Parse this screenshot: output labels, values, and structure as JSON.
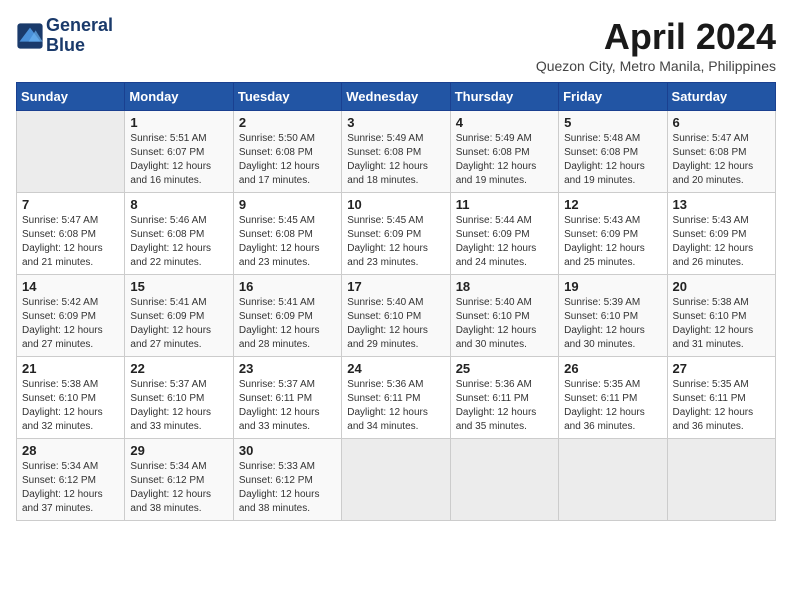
{
  "header": {
    "logo_line1": "General",
    "logo_line2": "Blue",
    "month_title": "April 2024",
    "subtitle": "Quezon City, Metro Manila, Philippines"
  },
  "weekdays": [
    "Sunday",
    "Monday",
    "Tuesday",
    "Wednesday",
    "Thursday",
    "Friday",
    "Saturday"
  ],
  "weeks": [
    [
      {
        "day": "",
        "info": ""
      },
      {
        "day": "1",
        "info": "Sunrise: 5:51 AM\nSunset: 6:07 PM\nDaylight: 12 hours\nand 16 minutes."
      },
      {
        "day": "2",
        "info": "Sunrise: 5:50 AM\nSunset: 6:08 PM\nDaylight: 12 hours\nand 17 minutes."
      },
      {
        "day": "3",
        "info": "Sunrise: 5:49 AM\nSunset: 6:08 PM\nDaylight: 12 hours\nand 18 minutes."
      },
      {
        "day": "4",
        "info": "Sunrise: 5:49 AM\nSunset: 6:08 PM\nDaylight: 12 hours\nand 19 minutes."
      },
      {
        "day": "5",
        "info": "Sunrise: 5:48 AM\nSunset: 6:08 PM\nDaylight: 12 hours\nand 19 minutes."
      },
      {
        "day": "6",
        "info": "Sunrise: 5:47 AM\nSunset: 6:08 PM\nDaylight: 12 hours\nand 20 minutes."
      }
    ],
    [
      {
        "day": "7",
        "info": "Sunrise: 5:47 AM\nSunset: 6:08 PM\nDaylight: 12 hours\nand 21 minutes."
      },
      {
        "day": "8",
        "info": "Sunrise: 5:46 AM\nSunset: 6:08 PM\nDaylight: 12 hours\nand 22 minutes."
      },
      {
        "day": "9",
        "info": "Sunrise: 5:45 AM\nSunset: 6:08 PM\nDaylight: 12 hours\nand 23 minutes."
      },
      {
        "day": "10",
        "info": "Sunrise: 5:45 AM\nSunset: 6:09 PM\nDaylight: 12 hours\nand 23 minutes."
      },
      {
        "day": "11",
        "info": "Sunrise: 5:44 AM\nSunset: 6:09 PM\nDaylight: 12 hours\nand 24 minutes."
      },
      {
        "day": "12",
        "info": "Sunrise: 5:43 AM\nSunset: 6:09 PM\nDaylight: 12 hours\nand 25 minutes."
      },
      {
        "day": "13",
        "info": "Sunrise: 5:43 AM\nSunset: 6:09 PM\nDaylight: 12 hours\nand 26 minutes."
      }
    ],
    [
      {
        "day": "14",
        "info": "Sunrise: 5:42 AM\nSunset: 6:09 PM\nDaylight: 12 hours\nand 27 minutes."
      },
      {
        "day": "15",
        "info": "Sunrise: 5:41 AM\nSunset: 6:09 PM\nDaylight: 12 hours\nand 27 minutes."
      },
      {
        "day": "16",
        "info": "Sunrise: 5:41 AM\nSunset: 6:09 PM\nDaylight: 12 hours\nand 28 minutes."
      },
      {
        "day": "17",
        "info": "Sunrise: 5:40 AM\nSunset: 6:10 PM\nDaylight: 12 hours\nand 29 minutes."
      },
      {
        "day": "18",
        "info": "Sunrise: 5:40 AM\nSunset: 6:10 PM\nDaylight: 12 hours\nand 30 minutes."
      },
      {
        "day": "19",
        "info": "Sunrise: 5:39 AM\nSunset: 6:10 PM\nDaylight: 12 hours\nand 30 minutes."
      },
      {
        "day": "20",
        "info": "Sunrise: 5:38 AM\nSunset: 6:10 PM\nDaylight: 12 hours\nand 31 minutes."
      }
    ],
    [
      {
        "day": "21",
        "info": "Sunrise: 5:38 AM\nSunset: 6:10 PM\nDaylight: 12 hours\nand 32 minutes."
      },
      {
        "day": "22",
        "info": "Sunrise: 5:37 AM\nSunset: 6:10 PM\nDaylight: 12 hours\nand 33 minutes."
      },
      {
        "day": "23",
        "info": "Sunrise: 5:37 AM\nSunset: 6:11 PM\nDaylight: 12 hours\nand 33 minutes."
      },
      {
        "day": "24",
        "info": "Sunrise: 5:36 AM\nSunset: 6:11 PM\nDaylight: 12 hours\nand 34 minutes."
      },
      {
        "day": "25",
        "info": "Sunrise: 5:36 AM\nSunset: 6:11 PM\nDaylight: 12 hours\nand 35 minutes."
      },
      {
        "day": "26",
        "info": "Sunrise: 5:35 AM\nSunset: 6:11 PM\nDaylight: 12 hours\nand 36 minutes."
      },
      {
        "day": "27",
        "info": "Sunrise: 5:35 AM\nSunset: 6:11 PM\nDaylight: 12 hours\nand 36 minutes."
      }
    ],
    [
      {
        "day": "28",
        "info": "Sunrise: 5:34 AM\nSunset: 6:12 PM\nDaylight: 12 hours\nand 37 minutes."
      },
      {
        "day": "29",
        "info": "Sunrise: 5:34 AM\nSunset: 6:12 PM\nDaylight: 12 hours\nand 38 minutes."
      },
      {
        "day": "30",
        "info": "Sunrise: 5:33 AM\nSunset: 6:12 PM\nDaylight: 12 hours\nand 38 minutes."
      },
      {
        "day": "",
        "info": ""
      },
      {
        "day": "",
        "info": ""
      },
      {
        "day": "",
        "info": ""
      },
      {
        "day": "",
        "info": ""
      }
    ]
  ]
}
